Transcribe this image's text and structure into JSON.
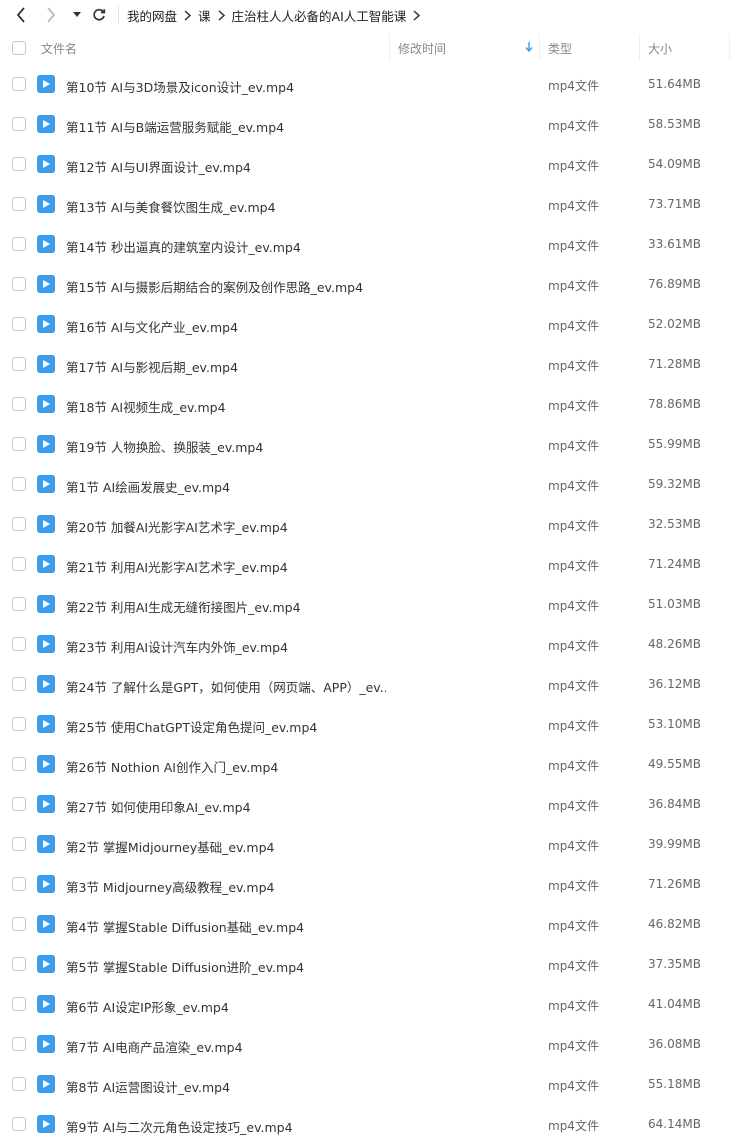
{
  "breadcrumb": [
    "我的网盘",
    "课",
    "庄治柱人人必备的AI人工智能课"
  ],
  "header": {
    "name": "文件名",
    "modified": "修改时间",
    "type": "类型",
    "size": "大小"
  },
  "colors": {
    "accent": "#3b9cf0"
  },
  "files": [
    {
      "name": "第10节 AI与3D场景及icon设计_ev.mp4",
      "type": "mp4文件",
      "size": "51.64MB"
    },
    {
      "name": "第11节 AI与B端运营服务赋能_ev.mp4",
      "type": "mp4文件",
      "size": "58.53MB"
    },
    {
      "name": "第12节 AI与UI界面设计_ev.mp4",
      "type": "mp4文件",
      "size": "54.09MB"
    },
    {
      "name": "第13节 AI与美食餐饮图生成_ev.mp4",
      "type": "mp4文件",
      "size": "73.71MB"
    },
    {
      "name": "第14节 秒出逼真的建筑室内设计_ev.mp4",
      "type": "mp4文件",
      "size": "33.61MB"
    },
    {
      "name": "第15节 AI与摄影后期结合的案例及创作思路_ev.mp4",
      "type": "mp4文件",
      "size": "76.89MB"
    },
    {
      "name": "第16节 AI与文化产业_ev.mp4",
      "type": "mp4文件",
      "size": "52.02MB"
    },
    {
      "name": "第17节 AI与影视后期_ev.mp4",
      "type": "mp4文件",
      "size": "71.28MB"
    },
    {
      "name": "第18节 AI视频生成_ev.mp4",
      "type": "mp4文件",
      "size": "78.86MB"
    },
    {
      "name": "第19节 人物换脸、换服装_ev.mp4",
      "type": "mp4文件",
      "size": "55.99MB"
    },
    {
      "name": "第1节 AI绘画发展史_ev.mp4",
      "type": "mp4文件",
      "size": "59.32MB"
    },
    {
      "name": "第20节 加餐AI光影字AI艺术字_ev.mp4",
      "type": "mp4文件",
      "size": "32.53MB"
    },
    {
      "name": "第21节 利用AI光影字AI艺术字_ev.mp4",
      "type": "mp4文件",
      "size": "71.24MB"
    },
    {
      "name": "第22节 利用AI生成无缝衔接图片_ev.mp4",
      "type": "mp4文件",
      "size": "51.03MB"
    },
    {
      "name": "第23节 利用AI设计汽车内外饰_ev.mp4",
      "type": "mp4文件",
      "size": "48.26MB"
    },
    {
      "name": "第24节 了解什么是GPT，如何使用（网页端、APP）_ev....",
      "type": "mp4文件",
      "size": "36.12MB"
    },
    {
      "name": "第25节 使用ChatGPT设定角色提问_ev.mp4",
      "type": "mp4文件",
      "size": "53.10MB"
    },
    {
      "name": "第26节 Nothion AI创作入门_ev.mp4",
      "type": "mp4文件",
      "size": "49.55MB"
    },
    {
      "name": "第27节 如何使用印象AI_ev.mp4",
      "type": "mp4文件",
      "size": "36.84MB"
    },
    {
      "name": "第2节 掌握Midjourney基础_ev.mp4",
      "type": "mp4文件",
      "size": "39.99MB"
    },
    {
      "name": "第3节 Midjourney高级教程_ev.mp4",
      "type": "mp4文件",
      "size": "71.26MB"
    },
    {
      "name": "第4节 掌握Stable Diffusion基础_ev.mp4",
      "type": "mp4文件",
      "size": "46.82MB"
    },
    {
      "name": "第5节 掌握Stable Diffusion进阶_ev.mp4",
      "type": "mp4文件",
      "size": "37.35MB"
    },
    {
      "name": "第6节 AI设定IP形象_ev.mp4",
      "type": "mp4文件",
      "size": "41.04MB"
    },
    {
      "name": "第7节 AI电商产品渲染_ev.mp4",
      "type": "mp4文件",
      "size": "36.08MB"
    },
    {
      "name": "第8节 AI运营图设计_ev.mp4",
      "type": "mp4文件",
      "size": "55.18MB"
    },
    {
      "name": "第9节 AI与二次元角色设定技巧_ev.mp4",
      "type": "mp4文件",
      "size": "64.14MB"
    }
  ]
}
